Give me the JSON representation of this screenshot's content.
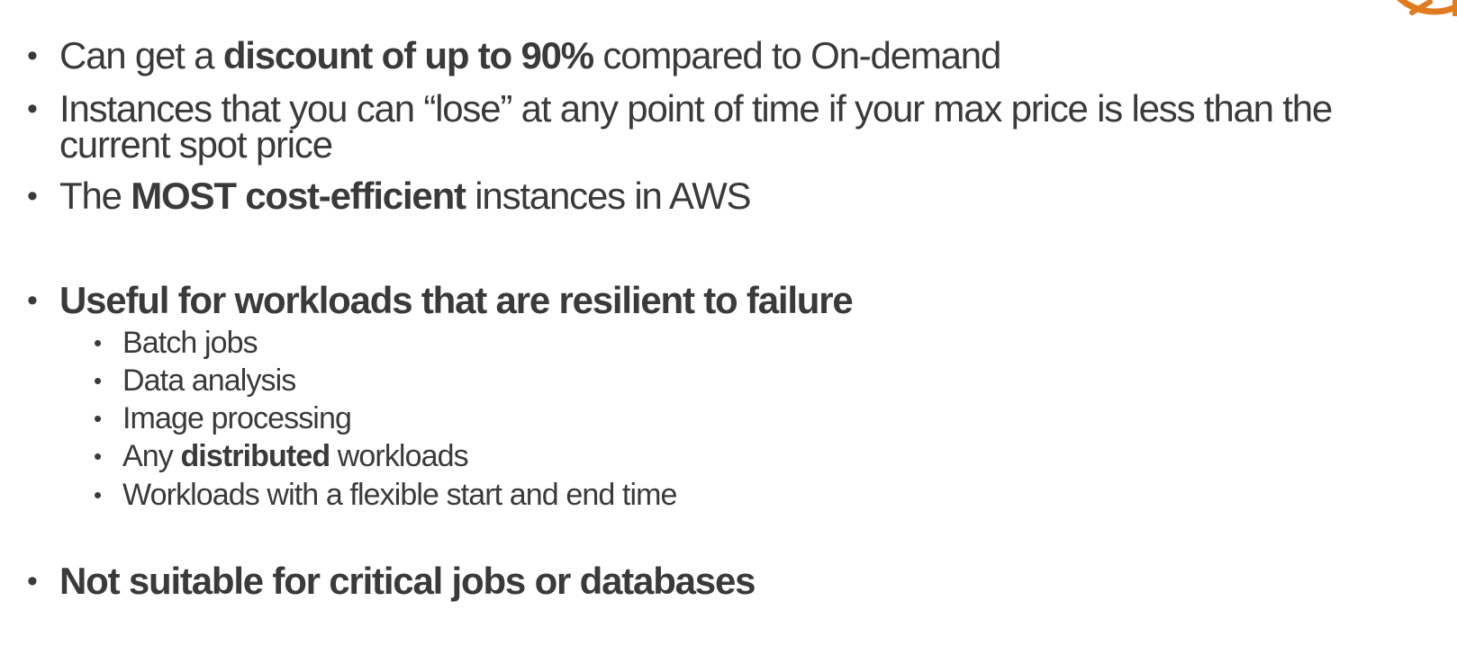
{
  "colors": {
    "text": "#3a3a3a",
    "accent": "#e07b1f"
  },
  "logo": {
    "icon": "spot-target-icon"
  },
  "bullets": [
    {
      "before": "Can get a ",
      "bold": "discount of up to 90%",
      "after": " compared to On-demand"
    },
    {
      "text": "Instances that you can “lose” at any point of time if your max price is less than the current spot price"
    },
    {
      "before": "The ",
      "bold": "MOST cost-efficient",
      "after": " instances in AWS"
    },
    {
      "text": "Useful for workloads that are resilient to failure"
    },
    {
      "text": "Not suitable for critical jobs or databases"
    }
  ],
  "sub_bullets": [
    {
      "text": "Batch jobs"
    },
    {
      "text": "Data analysis"
    },
    {
      "text": "Image processing"
    },
    {
      "before": "Any ",
      "bold": "distributed",
      "after": " workloads"
    },
    {
      "text": "Workloads with a flexible start and end time"
    }
  ]
}
